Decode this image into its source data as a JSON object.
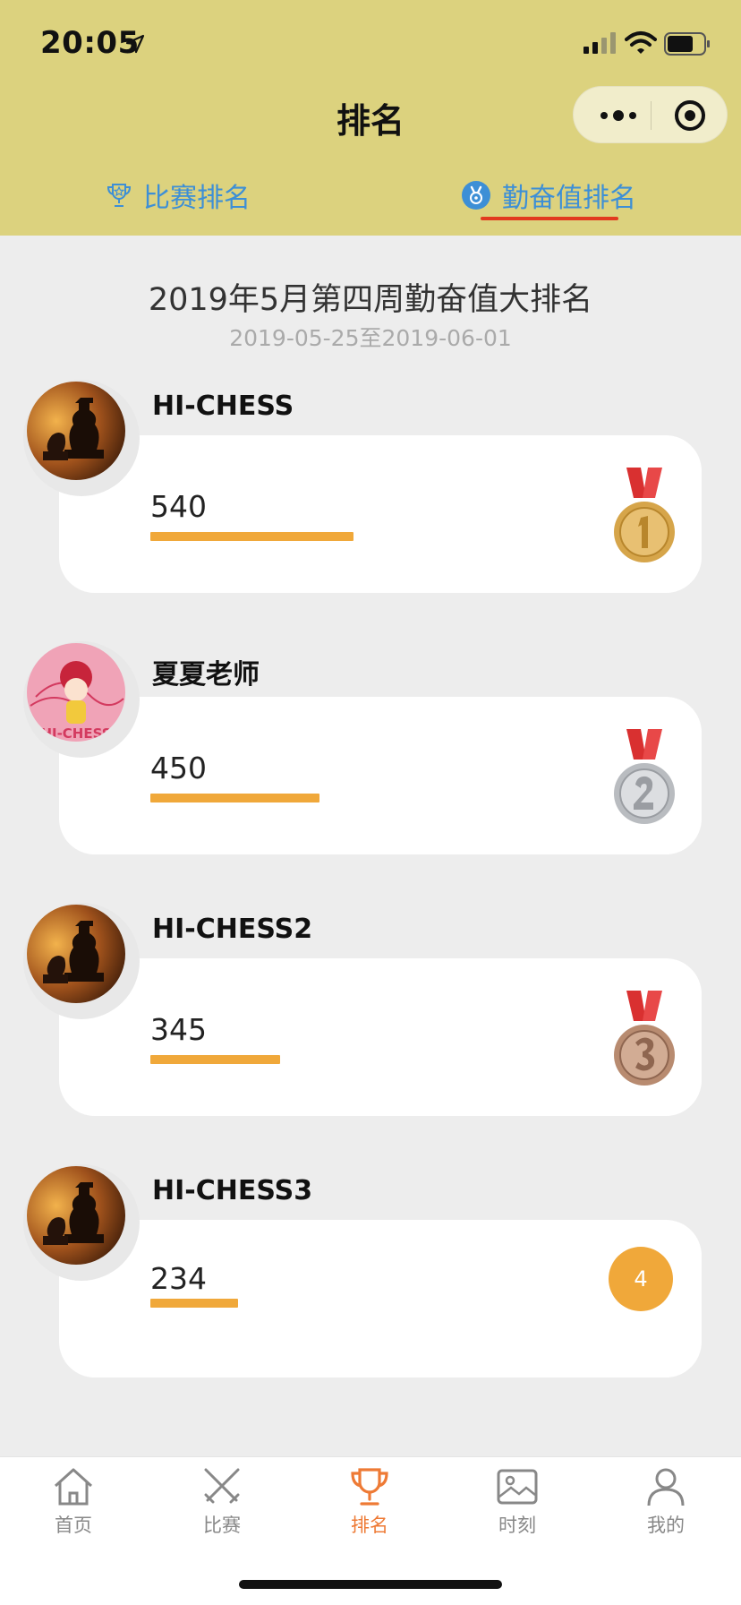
{
  "status_bar": {
    "time": "20:05"
  },
  "nav": {
    "title": "排名"
  },
  "tabs": [
    {
      "label": "比赛排名",
      "icon": "trophy-star-icon",
      "active": false
    },
    {
      "label": "勤奋值排名",
      "icon": "medal-badge-icon",
      "active": true
    }
  ],
  "period": {
    "title": "2019年5月第四周勤奋值大排名",
    "range": "2019-05-25至2019-06-01"
  },
  "rankings": [
    {
      "rank": 1,
      "name": "HI-CHESS",
      "score": "540",
      "progress": 0.54,
      "badge": "gold-medal-icon"
    },
    {
      "rank": 2,
      "name": "夏夏老师",
      "score": "450",
      "progress": 0.45,
      "badge": "silver-medal-icon"
    },
    {
      "rank": 3,
      "name": "HI-CHESS2",
      "score": "345",
      "progress": 0.345,
      "badge": "bronze-medal-icon"
    },
    {
      "rank": 4,
      "name": "HI-CHESS3",
      "score": "234",
      "progress": 0.234,
      "badge_text": "4"
    }
  ],
  "tabbar": [
    {
      "label": "首页",
      "icon": "home-icon",
      "active": false
    },
    {
      "label": "比赛",
      "icon": "crossed-swords-icon",
      "active": false
    },
    {
      "label": "排名",
      "icon": "trophy-icon",
      "active": true
    },
    {
      "label": "时刻",
      "icon": "photo-icon",
      "active": false
    },
    {
      "label": "我的",
      "icon": "person-icon",
      "active": false
    }
  ],
  "colors": {
    "header_bg": "#dcd27e",
    "tab_text": "#3d8fd6",
    "tab_underline": "#e23a1f",
    "progress_bar": "#f0a83a",
    "tabbar_active": "#ee7a35",
    "page_bg": "#ededed"
  }
}
